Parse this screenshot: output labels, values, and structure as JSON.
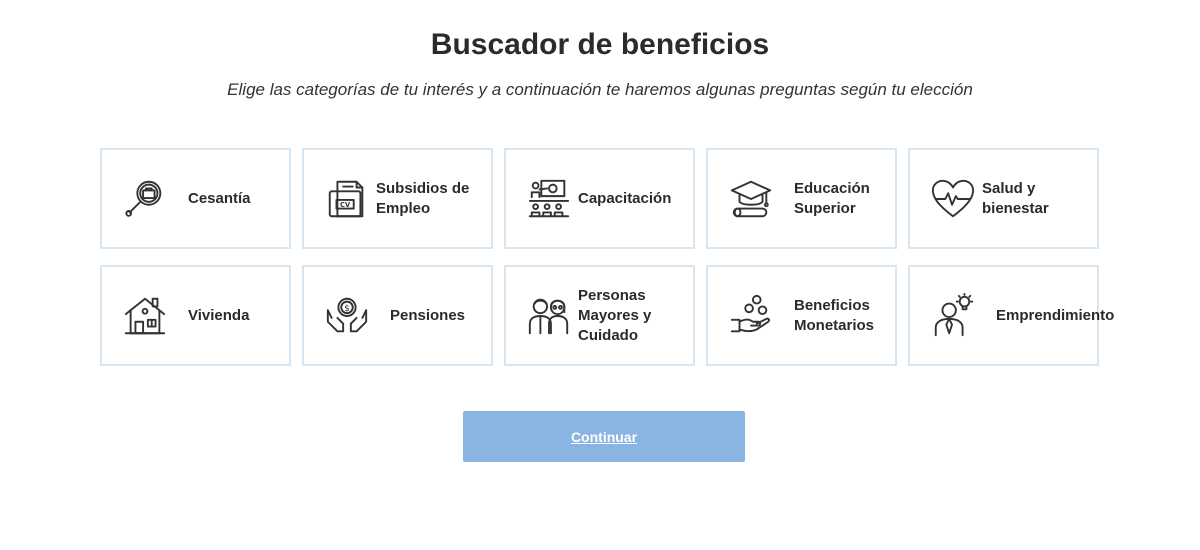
{
  "header": {
    "title": "Buscador de beneficios",
    "subtitle": "Elige las categorías de tu interés y a continuación te haremos algunas preguntas según tu elección"
  },
  "categories": [
    {
      "label": "Cesantía",
      "icon": "job-search-icon"
    },
    {
      "label": "Subsidios de Empleo",
      "icon": "cv-document-icon"
    },
    {
      "label": "Capacitación",
      "icon": "classroom-icon"
    },
    {
      "label": "Educación Superior",
      "icon": "graduation-cap-icon"
    },
    {
      "label": "Salud y bienestar",
      "icon": "heart-pulse-icon"
    },
    {
      "label": "Vivienda",
      "icon": "house-icon"
    },
    {
      "label": "Pensiones",
      "icon": "hands-coin-icon"
    },
    {
      "label": "Personas Mayores y Cuidado",
      "icon": "elderly-couple-icon"
    },
    {
      "label": "Beneficios Monetarios",
      "icon": "hand-coins-icon"
    },
    {
      "label": "Emprendimiento",
      "icon": "entrepreneur-icon"
    }
  ],
  "actions": {
    "continue_label": "Continuar"
  },
  "colors": {
    "card_border": "#d7e6f1",
    "button_bg": "#8ab4e2",
    "text": "#2b2b2b"
  }
}
